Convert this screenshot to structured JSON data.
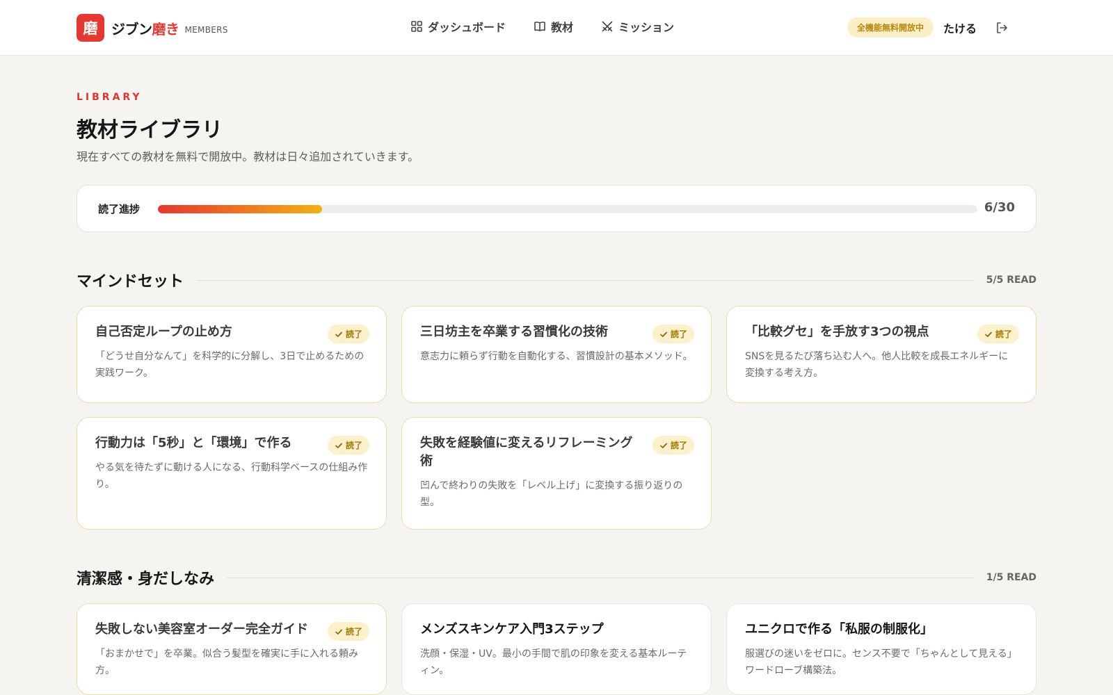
{
  "header": {
    "logo_char": "磨",
    "brand_main": "ジブン",
    "brand_accent": "磨き",
    "brand_sub": "MEMBERS",
    "nav": [
      {
        "label": "ダッシュボード",
        "icon": "grid-icon"
      },
      {
        "label": "教材",
        "icon": "book-icon"
      },
      {
        "label": "ミッション",
        "icon": "swords-icon"
      }
    ],
    "free_badge": "全機能無料開放中",
    "username": "たける",
    "logout_icon": "logout-icon"
  },
  "hero": {
    "eyebrow": "LIBRARY",
    "title": "教材ライブラリ",
    "subtitle": "現在すべての教材を無料で開放中。教材は日々追加されていきます。"
  },
  "progress": {
    "label": "読了進捗",
    "count": "6/30",
    "read": 6,
    "total": 30
  },
  "colors": {
    "accent": "#e23a32",
    "progress_start": "#e6372f",
    "progress_end": "#f4b015",
    "read_badge_bg": "#fcf1cc"
  },
  "sections": [
    {
      "title": "マインドセット",
      "count": "5/5 READ",
      "items": [
        {
          "title": "自己否定ループの止め方",
          "desc": "「どうせ自分なんて」を科学的に分解し、3日で止めるための実践ワーク。",
          "read": true,
          "badge": "読了"
        },
        {
          "title": "三日坊主を卒業する習慣化の技術",
          "desc": "意志力に頼らず行動を自動化する、習慣設計の基本メソッド。",
          "read": true,
          "badge": "読了"
        },
        {
          "title": "「比較グセ」を手放す3つの視点",
          "desc": "SNSを見るたび落ち込む人へ。他人比較を成長エネルギーに変換する考え方。",
          "read": true,
          "badge": "読了"
        },
        {
          "title": "行動力は「5秒」と「環境」で作る",
          "desc": "やる気を待たずに動ける人になる、行動科学ベースの仕組み作り。",
          "read": true,
          "badge": "読了"
        },
        {
          "title": "失敗を経験値に変えるリフレーミング術",
          "desc": "凹んで終わりの失敗を「レベル上げ」に変換する振り返りの型。",
          "read": true,
          "badge": "読了"
        }
      ]
    },
    {
      "title": "清潔感・身だしなみ",
      "count": "1/5 READ",
      "items": [
        {
          "title": "失敗しない美容室オーダー完全ガイド",
          "desc": "「おまかせで」を卒業。似合う髪型を確実に手に入れる頼み方。",
          "read": true,
          "badge": "読了"
        },
        {
          "title": "メンズスキンケア入門3ステップ",
          "desc": "洗顔・保湿・UV。最小の手間で肌の印象を変える基本ルーティン。",
          "read": false,
          "badge": ""
        },
        {
          "title": "ユニクロで作る「私服の制服化」",
          "desc": "服選びの迷いをゼロに。センス不要で「ちゃんとして見える」ワードローブ構築法。",
          "read": false,
          "badge": ""
        }
      ]
    }
  ]
}
